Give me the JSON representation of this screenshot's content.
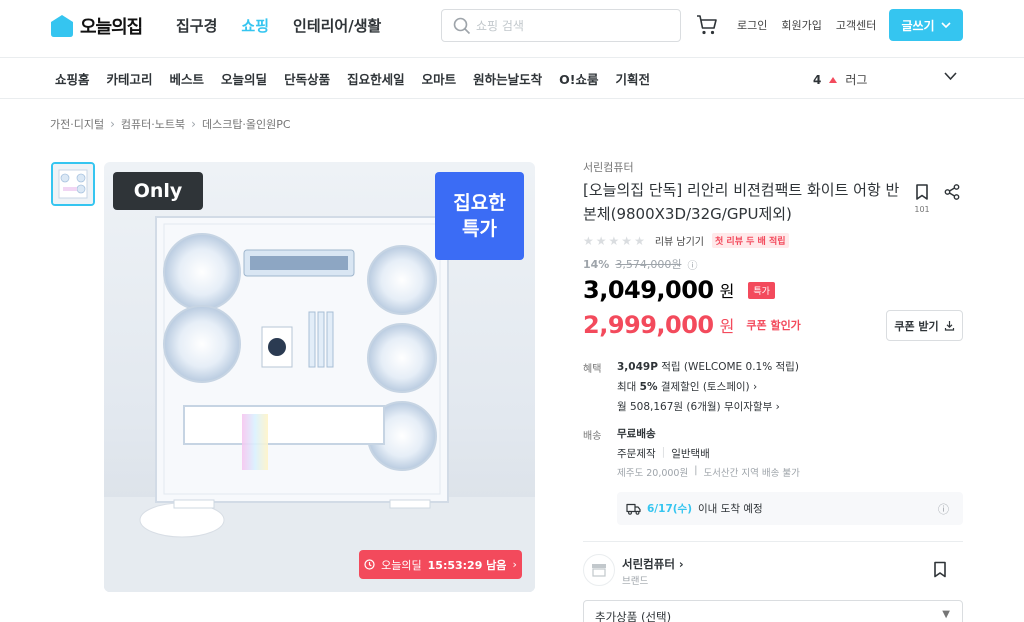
{
  "header": {
    "logo_text": "오늘의집",
    "nav": [
      "집구경",
      "쇼핑",
      "인테리어/생활"
    ],
    "active_nav": "쇼핑",
    "search_placeholder": "쇼핑 검색",
    "util_links": [
      "로그인",
      "회원가입",
      "고객센터"
    ],
    "write_button": "글쓰기"
  },
  "category_nav": {
    "items": [
      "쇼핑홈",
      "카테고리",
      "베스트",
      "오늘의딜",
      "단독상품",
      "집요한세일",
      "오마트",
      "원하는날도착",
      "O!쇼룸",
      "기획전"
    ],
    "rank_number": "4",
    "rank_keyword": "러그"
  },
  "breadcrumb": [
    "가전·디지털",
    "컴퓨터·노트북",
    "데스크탑·올인원PC"
  ],
  "gallery": {
    "only_badge": "Only",
    "deal_badge_line1": "집요한",
    "deal_badge_line2": "특가",
    "timer_label": "오늘의딜",
    "timer_time": "15:53:29 남음"
  },
  "product": {
    "brand": "서린컴퓨터",
    "title": "[오늘의집 단독] 리안리 비젼컴팩트 화이트 어항 반본체(9800X3D/32G/GPU제외)",
    "bookmark_count": "101",
    "review_link": "리뷰 남기기",
    "review_badge": "첫 리뷰 두 배 적립",
    "discount_pct": "14%",
    "original_price": "3,574,000원",
    "price": "3,049,000",
    "won": "원",
    "special_badge": "특가",
    "coupon_price": "2,999,000",
    "coupon_note": "쿠폰 할인가",
    "coupon_button": "쿠폰 받기"
  },
  "benefits": {
    "label": "혜택",
    "points": "3,049P",
    "points_desc": "적립 (WELCOME 0.1% 적립)",
    "card_prefix": "최대",
    "card_pct": "5%",
    "card_desc": "결제할인 (토스페이)",
    "installment": "월 508,167원 (6개월) 무이자할부"
  },
  "shipping": {
    "label": "배송",
    "fee": "무료배송",
    "type1": "주문제작",
    "type2": "일반택배",
    "extra1": "제주도 20,000원",
    "extra2": "도서산간 지역 배송 불가",
    "arrive_date": "6/17(수)",
    "arrive_text": "이내 도착 예정"
  },
  "seller": {
    "name": "서린컴퓨터",
    "type": "브랜드"
  },
  "addon": {
    "label": "추가상품 (선택)"
  },
  "colors": {
    "accent": "#35c5f0",
    "sale": "#f34a5c",
    "deal_blue": "#3b6cf5"
  }
}
